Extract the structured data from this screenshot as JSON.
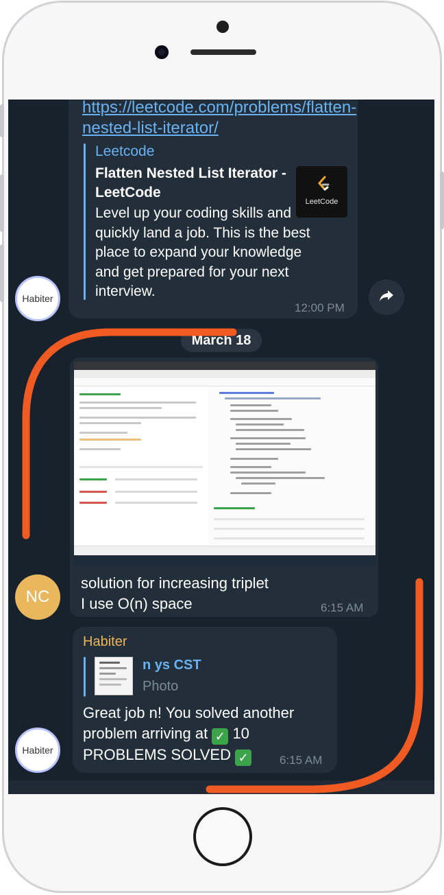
{
  "message_1": {
    "link": "https://leetcode.com/problems/flatten-nested-list-iterator/",
    "preview_site": "Leetcode",
    "preview_title": "Flatten Nested List Iterator - LeetCode",
    "preview_description": "Level up your coding skills and quickly land a job. This is the best place to expand your knowledge and get prepared for your next interview.",
    "thumb_label": "LeetCode",
    "time": "12:00 PM",
    "avatar_label": "Habiter"
  },
  "date_separator": "March 18",
  "message_2": {
    "avatar_initials": "NC",
    "text_line1": "solution for increasing triplet",
    "text_line2": "I use O(n) space",
    "time": "6:15 AM"
  },
  "message_3": {
    "sender": "Habiter",
    "reply_name": "n ys CST",
    "reply_type": "Photo",
    "text_line1": "Great job n! You solved another",
    "text_line2": "problem arriving at",
    "count": "10",
    "text_line3": "PROBLEMS SOLVED",
    "time": "6:15 AM",
    "avatar_label": "Habiter"
  },
  "colors": {
    "screen_bg": "#18222d",
    "bubble_bg": "#222e3a",
    "link": "#6ab2f2",
    "sender": "#f0b45a",
    "annotation": "#f05a23",
    "avatar_nc": "#e9b85e"
  },
  "icons": [
    "share-icon",
    "checkmark-icon",
    "leetcode-logo-icon"
  ]
}
